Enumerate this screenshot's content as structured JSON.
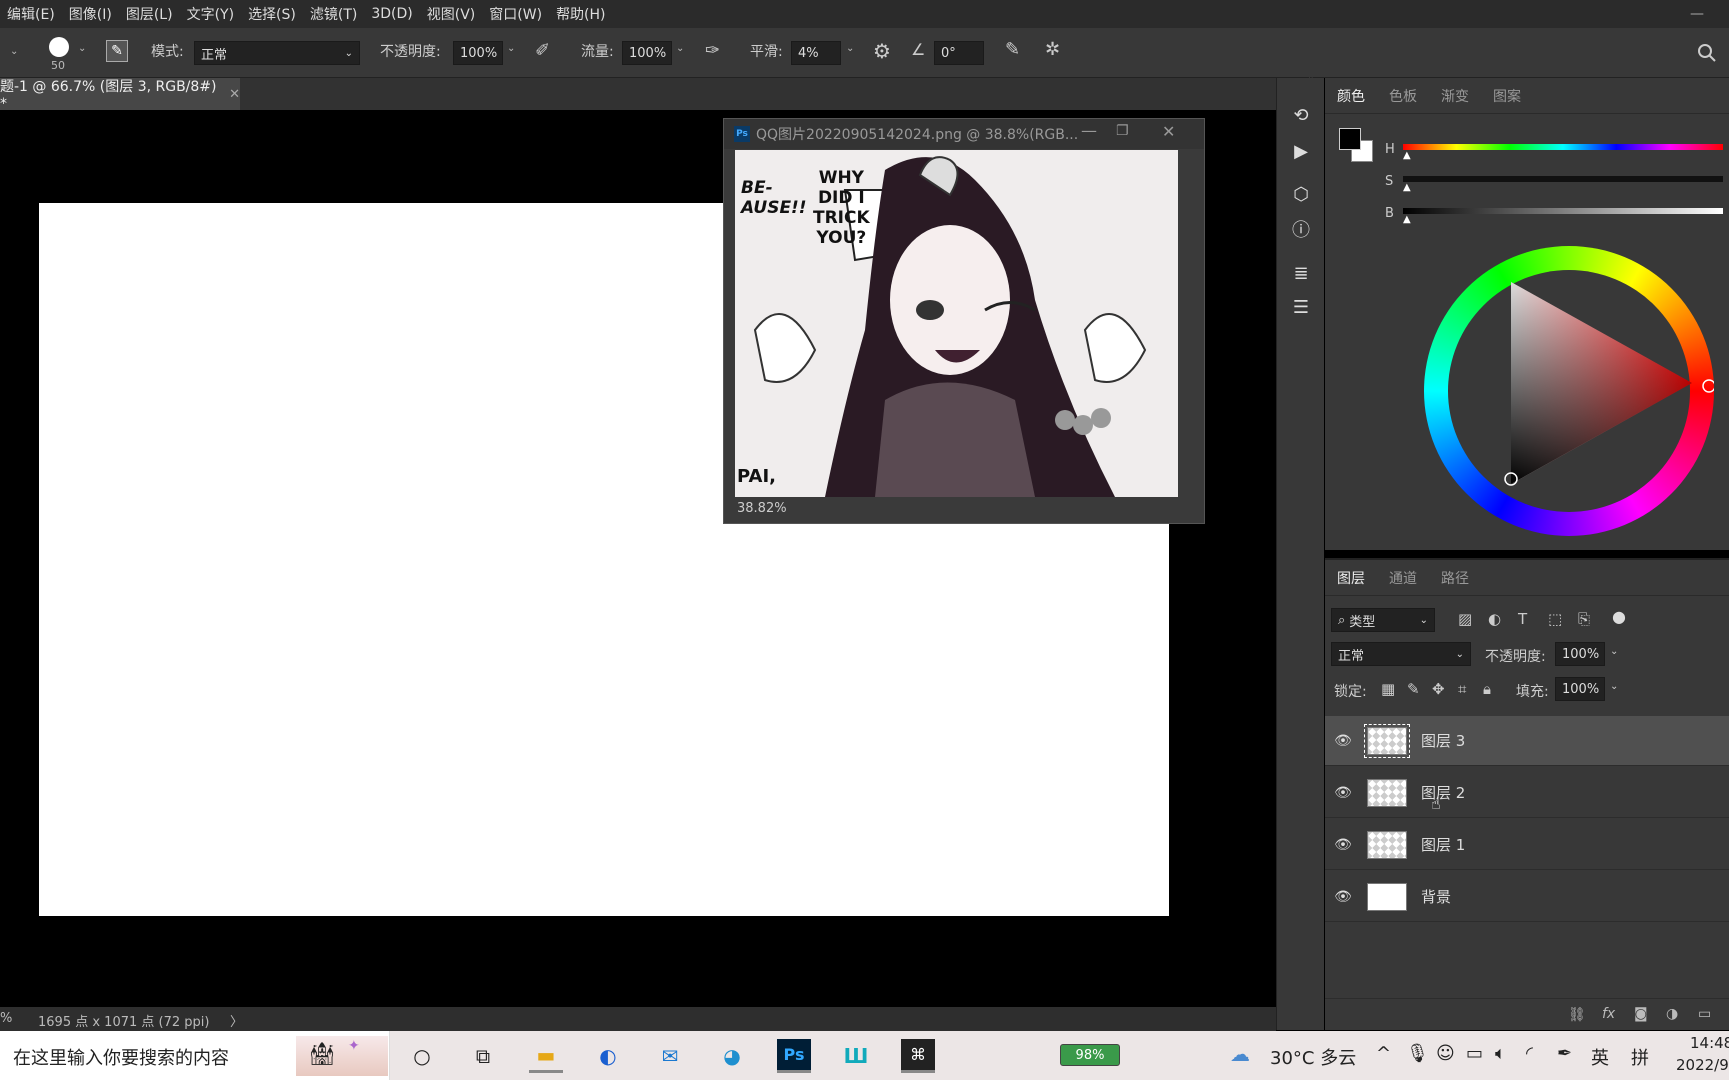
{
  "menu": [
    "编辑(E)",
    "图像(I)",
    "图层(L)",
    "文字(Y)",
    "选择(S)",
    "滤镜(T)",
    "3D(D)",
    "视图(V)",
    "窗口(W)",
    "帮助(H)"
  ],
  "options": {
    "brush_size": "50",
    "mode_label": "模式:",
    "mode_value": "正常",
    "opacity_label": "不透明度:",
    "opacity_value": "100%",
    "flow_label": "流量:",
    "flow_value": "100%",
    "smooth_label": "平滑:",
    "smooth_value": "4%",
    "angle_value": "0°"
  },
  "document": {
    "tab_title": "题-1 @ 66.7% (图层 3, RGB/8#) *",
    "status": "1695 点 x 1071 点 (72 ppi)",
    "status_left": "%"
  },
  "floating_window": {
    "title": "QQ图片20220905142024.png @ 38.8%(RGB...",
    "zoom": "38.82%",
    "bubble_left": "BE-\nAUSE!!",
    "bubble_right": "WHY\nDID I\nTRICK\nYOU?",
    "corner_text": "PAI,"
  },
  "color_panel": {
    "tabs": [
      "颜色",
      "色板",
      "渐变",
      "图案"
    ],
    "sliders": [
      "H",
      "S",
      "B"
    ],
    "foreground": "#000000",
    "background": "#ffffff"
  },
  "layers_panel": {
    "tabs": [
      "图层",
      "通道",
      "路径"
    ],
    "filter_label": "类型",
    "blend_mode": "正常",
    "opacity_label": "不透明度:",
    "opacity_value": "100%",
    "lock_label": "锁定:",
    "fill_label": "填充:",
    "fill_value": "100%",
    "layers": [
      {
        "name": "图层 3",
        "selected": true
      },
      {
        "name": "图层 2",
        "selected": false
      },
      {
        "name": "图层 1",
        "selected": false
      },
      {
        "name": "背景",
        "selected": false
      }
    ]
  },
  "taskbar": {
    "search_placeholder": "在这里输入你要搜索的内容",
    "battery": "98%",
    "weather": "30°C 多云",
    "ime_lang": "英",
    "ime_mode": "拼",
    "time": "14:48",
    "date": "2022/9"
  }
}
